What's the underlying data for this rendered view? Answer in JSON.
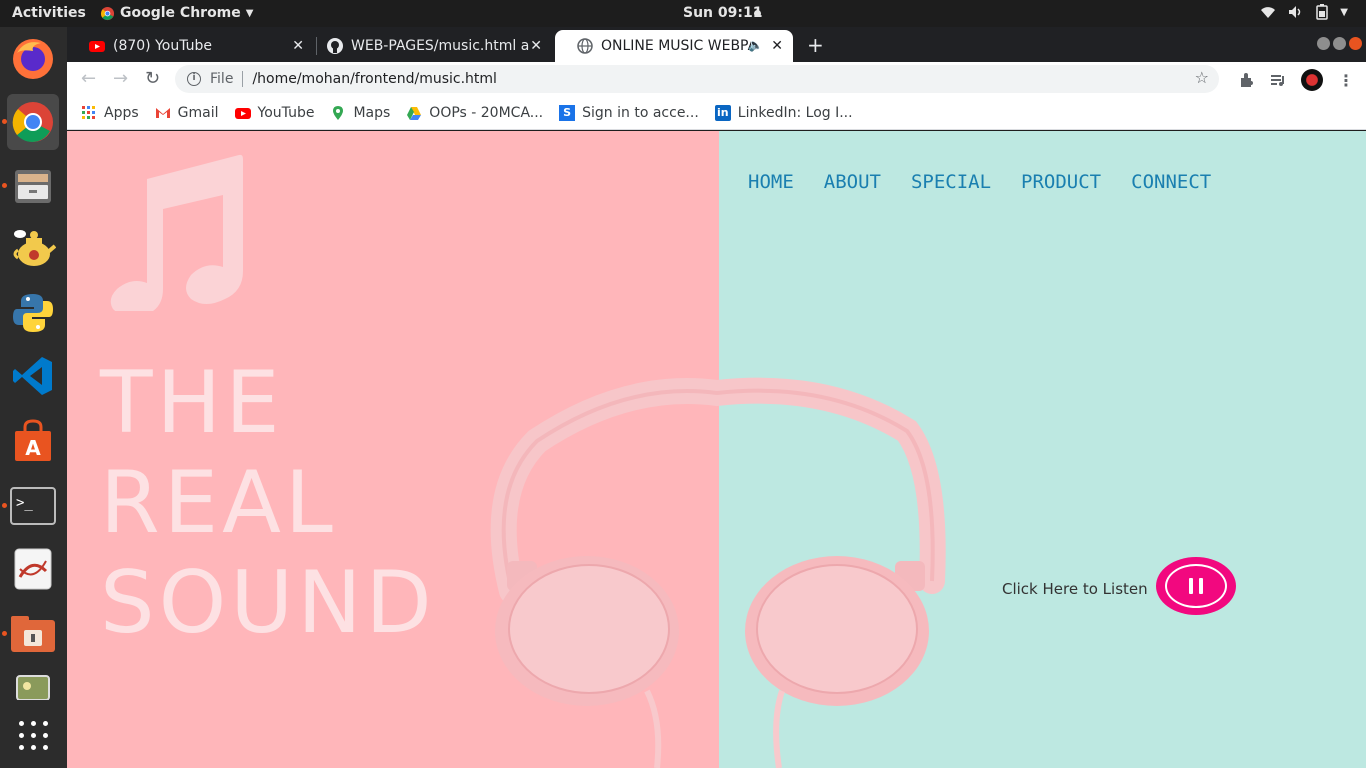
{
  "topbar": {
    "activities": "Activities",
    "app_name": "Google Chrome",
    "clock": "Sun 09:11"
  },
  "tabs": [
    {
      "title": "(870) YouTube",
      "icon": "youtube-icon"
    },
    {
      "title": "WEB-PAGES/music.html a",
      "icon": "github-icon"
    },
    {
      "title": "ONLINE MUSIC WEBPA",
      "icon": "globe-icon",
      "active": true
    }
  ],
  "toolbar": {
    "scheme": "File",
    "url": "/home/mohan/frontend/music.html"
  },
  "bookmarks": [
    {
      "label": "Apps",
      "icon": "apps-grid-icon"
    },
    {
      "label": "Gmail",
      "icon": "gmail-icon"
    },
    {
      "label": "YouTube",
      "icon": "youtube-icon"
    },
    {
      "label": "Maps",
      "icon": "maps-icon"
    },
    {
      "label": "OOPs - 20MCA...",
      "icon": "drive-icon"
    },
    {
      "label": "Sign in to acce...",
      "icon": "s-icon"
    },
    {
      "label": "LinkedIn: Log I...",
      "icon": "linkedin-icon"
    }
  ],
  "page": {
    "title_lines": [
      "THE",
      "REAL",
      "SOUND"
    ],
    "nav": [
      "HOME",
      "ABOUT",
      "SPECIAL",
      "PRODUCT",
      "CONNECT"
    ],
    "listen_text": "Click Here to Listen",
    "colors": {
      "left_bg": "#ffb6ba",
      "right_bg": "#bde8e1",
      "nav": "#1a7fb0",
      "play_button": "#f2087f"
    }
  }
}
